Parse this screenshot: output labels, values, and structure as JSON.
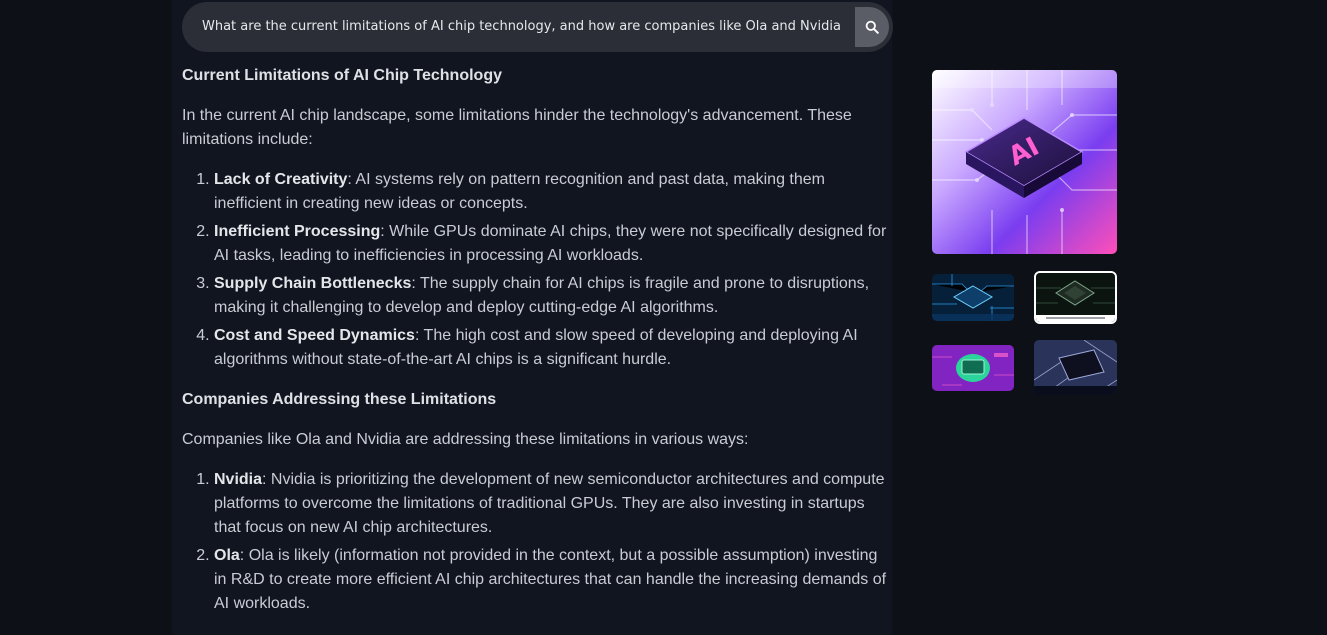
{
  "search": {
    "query": "What are the current limitations of AI chip technology, and how are companies like Ola and Nvidia addressing them?"
  },
  "answer": {
    "section1_heading": "Current Limitations of AI Chip Technology",
    "section1_intro": "In the current AI chip landscape, some limitations hinder the technology's advancement. These limitations include:",
    "limitations": [
      {
        "title": "Lack of Creativity",
        "text": ": AI systems rely on pattern recognition and past data, making them inefficient in creating new ideas or concepts."
      },
      {
        "title": "Inefficient Processing",
        "text": ": While GPUs dominate AI chips, they were not specifically designed for AI tasks, leading to inefficiencies in processing AI workloads."
      },
      {
        "title": "Supply Chain Bottlenecks",
        "text": ": The supply chain for AI chips is fragile and prone to disruptions, making it challenging to develop and deploy cutting-edge AI algorithms."
      },
      {
        "title": "Cost and Speed Dynamics",
        "text": ": The high cost and slow speed of developing and deploying AI algorithms without state-of-the-art AI chips is a significant hurdle."
      }
    ],
    "section2_heading": "Companies Addressing these Limitations",
    "section2_intro": "Companies like Ola and Nvidia are addressing these limitations in various ways:",
    "companies": [
      {
        "title": "Nvidia",
        "text": ": Nvidia is prioritizing the development of new semiconductor architectures and compute platforms to overcome the limitations of traditional GPUs. They are also investing in startups that focus on new AI chip architectures."
      },
      {
        "title": "Ola",
        "text": ": Ola is likely (information not provided in the context, but a possible assumption) investing in R&D to create more efficient AI chip architectures that can handle the increasing demands of AI workloads."
      }
    ]
  },
  "images": {
    "main_label": "AI",
    "icons": [
      "search-icon"
    ]
  },
  "colors": {
    "background": "#0d1017",
    "panel": "#111520",
    "search_bar": "#2b2e36",
    "search_button": "#5a5d66",
    "text": "#c9ccd3"
  }
}
